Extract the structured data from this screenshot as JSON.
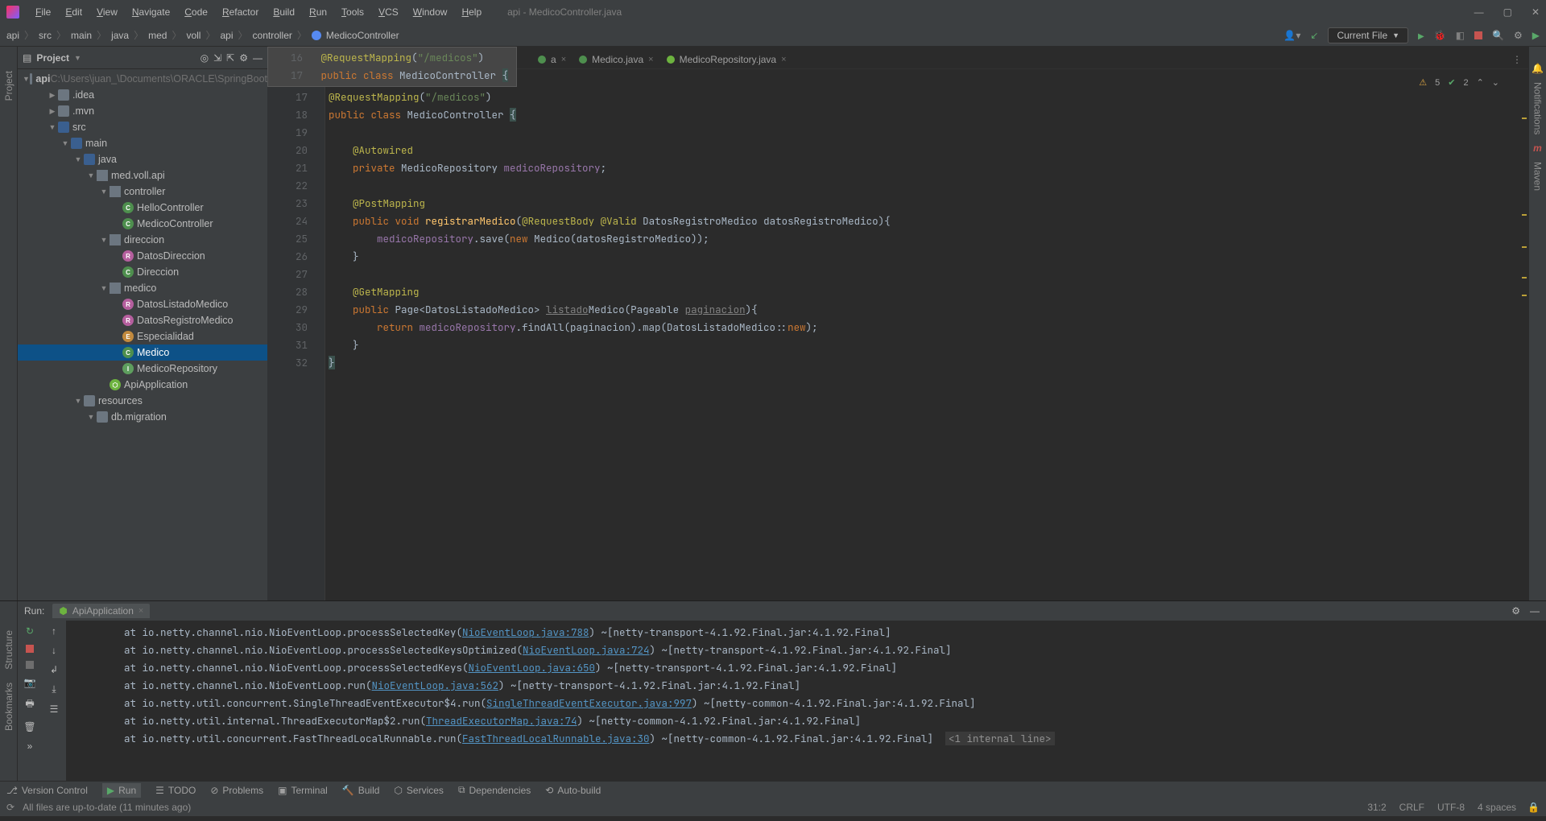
{
  "window": {
    "title": "api - MedicoController.java"
  },
  "menu": [
    "File",
    "Edit",
    "View",
    "Navigate",
    "Code",
    "Refactor",
    "Build",
    "Run",
    "Tools",
    "VCS",
    "Window",
    "Help"
  ],
  "breadcrumbs": [
    "api",
    "src",
    "main",
    "java",
    "med",
    "voll",
    "api",
    "controller",
    "MedicoController"
  ],
  "nav": {
    "current_file": "Current File"
  },
  "left_rail": {
    "project": "Project"
  },
  "right_rail": {
    "notifications": "Notifications",
    "maven": "Maven"
  },
  "project_panel": {
    "title": "Project",
    "root": "api",
    "root_path": "C:\\Users\\juan_\\Documents\\ORACLE\\SpringBoot",
    "nodes": [
      {
        "d": 1,
        "exp": "",
        "icon": "folder",
        "label": ".idea"
      },
      {
        "d": 1,
        "exp": "",
        "icon": "folder",
        "label": ".mvn"
      },
      {
        "d": 1,
        "exp": "open",
        "icon": "folder-src",
        "label": "src"
      },
      {
        "d": 2,
        "exp": "open",
        "icon": "folder-src",
        "label": "main"
      },
      {
        "d": 3,
        "exp": "open",
        "icon": "folder-src",
        "label": "java"
      },
      {
        "d": 4,
        "exp": "open",
        "icon": "pkg",
        "label": "med.voll.api"
      },
      {
        "d": 5,
        "exp": "open",
        "icon": "pkg",
        "label": "controller"
      },
      {
        "d": 6,
        "exp": "",
        "icon": "cls",
        "label": "HelloController"
      },
      {
        "d": 6,
        "exp": "",
        "icon": "cls",
        "label": "MedicoController"
      },
      {
        "d": 5,
        "exp": "open",
        "icon": "pkg",
        "label": "direccion"
      },
      {
        "d": 6,
        "exp": "",
        "icon": "rec",
        "label": "DatosDireccion"
      },
      {
        "d": 6,
        "exp": "",
        "icon": "cls",
        "label": "Direccion"
      },
      {
        "d": 5,
        "exp": "open",
        "icon": "pkg",
        "label": "medico"
      },
      {
        "d": 6,
        "exp": "",
        "icon": "rec",
        "label": "DatosListadoMedico"
      },
      {
        "d": 6,
        "exp": "",
        "icon": "rec",
        "label": "DatosRegistroMedico"
      },
      {
        "d": 6,
        "exp": "",
        "icon": "enu",
        "label": "Especialidad"
      },
      {
        "d": 6,
        "exp": "",
        "icon": "cls",
        "label": "Medico",
        "sel": true
      },
      {
        "d": 6,
        "exp": "",
        "icon": "int",
        "label": "MedicoRepository"
      },
      {
        "d": 5,
        "exp": "",
        "icon": "spring",
        "label": "ApiApplication"
      },
      {
        "d": 3,
        "exp": "open",
        "icon": "folder",
        "label": "resources"
      },
      {
        "d": 4,
        "exp": "open",
        "icon": "folder",
        "label": "db.migration"
      }
    ]
  },
  "editor": {
    "tabs": [
      {
        "icon": "cls",
        "label": "a",
        "rest": ""
      },
      {
        "icon": "cls",
        "label": "Medico.java"
      },
      {
        "icon": "int",
        "label": "MedicoRepository.java"
      }
    ],
    "overlay_top": "@RequestMapping(\"/medicos\")",
    "overlay_bot": "public class MedicoController {",
    "lines": [
      "16",
      "17",
      "18",
      "19",
      "20",
      "21",
      "22",
      "23",
      "24",
      "25",
      "26",
      "27",
      "28",
      "29",
      "30",
      "31",
      "32"
    ],
    "insp": {
      "warn": "5",
      "check": "2"
    }
  },
  "run": {
    "label": "Run:",
    "tab": "ApiApplication",
    "lines": [
      {
        "pre": "        at io.netty.channel.nio.NioEventLoop.processSelectedKey(",
        "link": "NioEventLoop.java:788",
        "post": ") ~[netty-transport-4.1.92.Final.jar:4.1.92.Final]"
      },
      {
        "pre": "        at io.netty.channel.nio.NioEventLoop.processSelectedKeysOptimized(",
        "link": "NioEventLoop.java:724",
        "post": ") ~[netty-transport-4.1.92.Final.jar:4.1.92.Final]"
      },
      {
        "pre": "        at io.netty.channel.nio.NioEventLoop.processSelectedKeys(",
        "link": "NioEventLoop.java:650",
        "post": ") ~[netty-transport-4.1.92.Final.jar:4.1.92.Final]"
      },
      {
        "pre": "        at io.netty.channel.nio.NioEventLoop.run(",
        "link": "NioEventLoop.java:562",
        "post": ") ~[netty-transport-4.1.92.Final.jar:4.1.92.Final]"
      },
      {
        "pre": "        at io.netty.util.concurrent.SingleThreadEventExecutor$4.run(",
        "link": "SingleThreadEventExecutor.java:997",
        "post": ") ~[netty-common-4.1.92.Final.jar:4.1.92.Final]"
      },
      {
        "pre": "        at io.netty.util.internal.ThreadExecutorMap$2.run(",
        "link": "ThreadExecutorMap.java:74",
        "post": ") ~[netty-common-4.1.92.Final.jar:4.1.92.Final]"
      },
      {
        "pre": "        at io.netty.util.concurrent.FastThreadLocalRunnable.run(",
        "link": "FastThreadLocalRunnable.java:30",
        "post": ") ~[netty-common-4.1.92.Final.jar:4.1.92.Final] ",
        "box": "<1 internal line>"
      }
    ]
  },
  "bottom": {
    "items": [
      "Version Control",
      "Run",
      "TODO",
      "Problems",
      "Terminal",
      "Build",
      "Services",
      "Dependencies",
      "Auto-build"
    ]
  },
  "status": {
    "msg": "All files are up-to-date (11 minutes ago)",
    "right": [
      "31:2",
      "CRLF",
      "UTF-8",
      "4 spaces"
    ]
  }
}
